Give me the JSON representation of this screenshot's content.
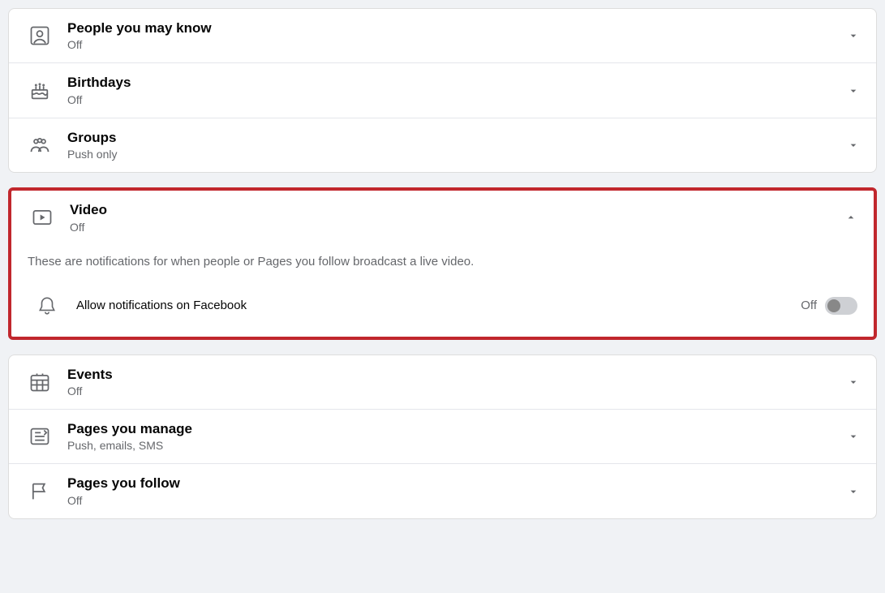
{
  "group1": {
    "items": [
      {
        "title": "People you may know",
        "status": "Off"
      },
      {
        "title": "Birthdays",
        "status": "Off"
      },
      {
        "title": "Groups",
        "status": "Push only"
      }
    ]
  },
  "video": {
    "title": "Video",
    "status": "Off",
    "description": "These are notifications for when people or Pages you follow broadcast a live video.",
    "allow_label": "Allow notifications on Facebook",
    "toggle_state": "Off"
  },
  "group2": {
    "items": [
      {
        "title": "Events",
        "status": "Off"
      },
      {
        "title": "Pages you manage",
        "status": "Push, emails, SMS"
      },
      {
        "title": "Pages you follow",
        "status": "Off"
      }
    ]
  }
}
